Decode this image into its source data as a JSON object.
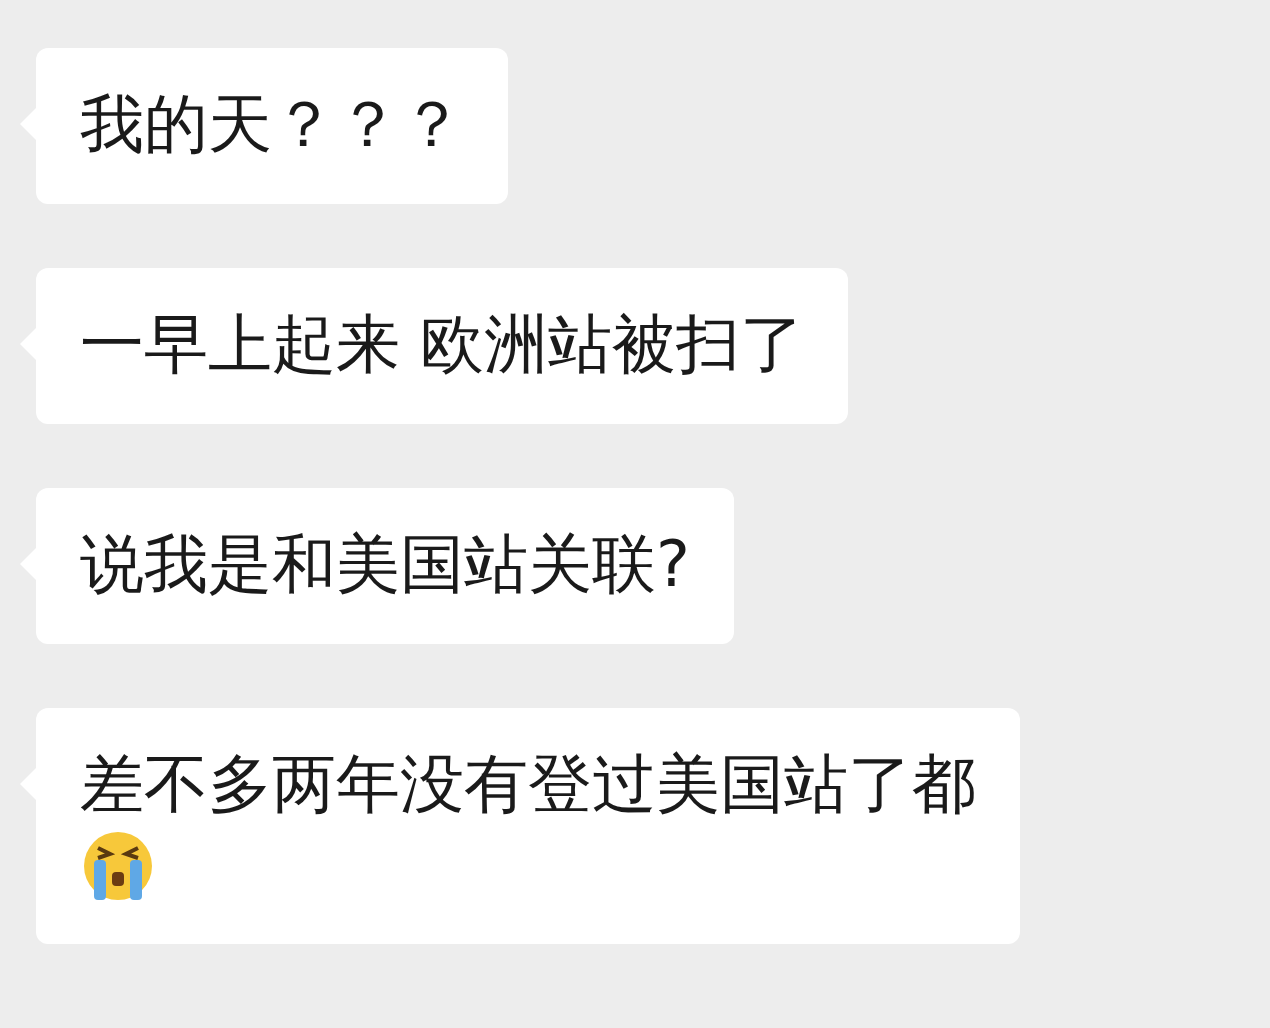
{
  "messages": [
    {
      "text": "我的天？？？",
      "emoji": false
    },
    {
      "text": "一早上起来 欧洲站被扫了",
      "emoji": false
    },
    {
      "text": "说我是和美国站关联?",
      "emoji": false
    },
    {
      "text": "差不多两年没有登过美国站了都",
      "emoji": true
    }
  ]
}
